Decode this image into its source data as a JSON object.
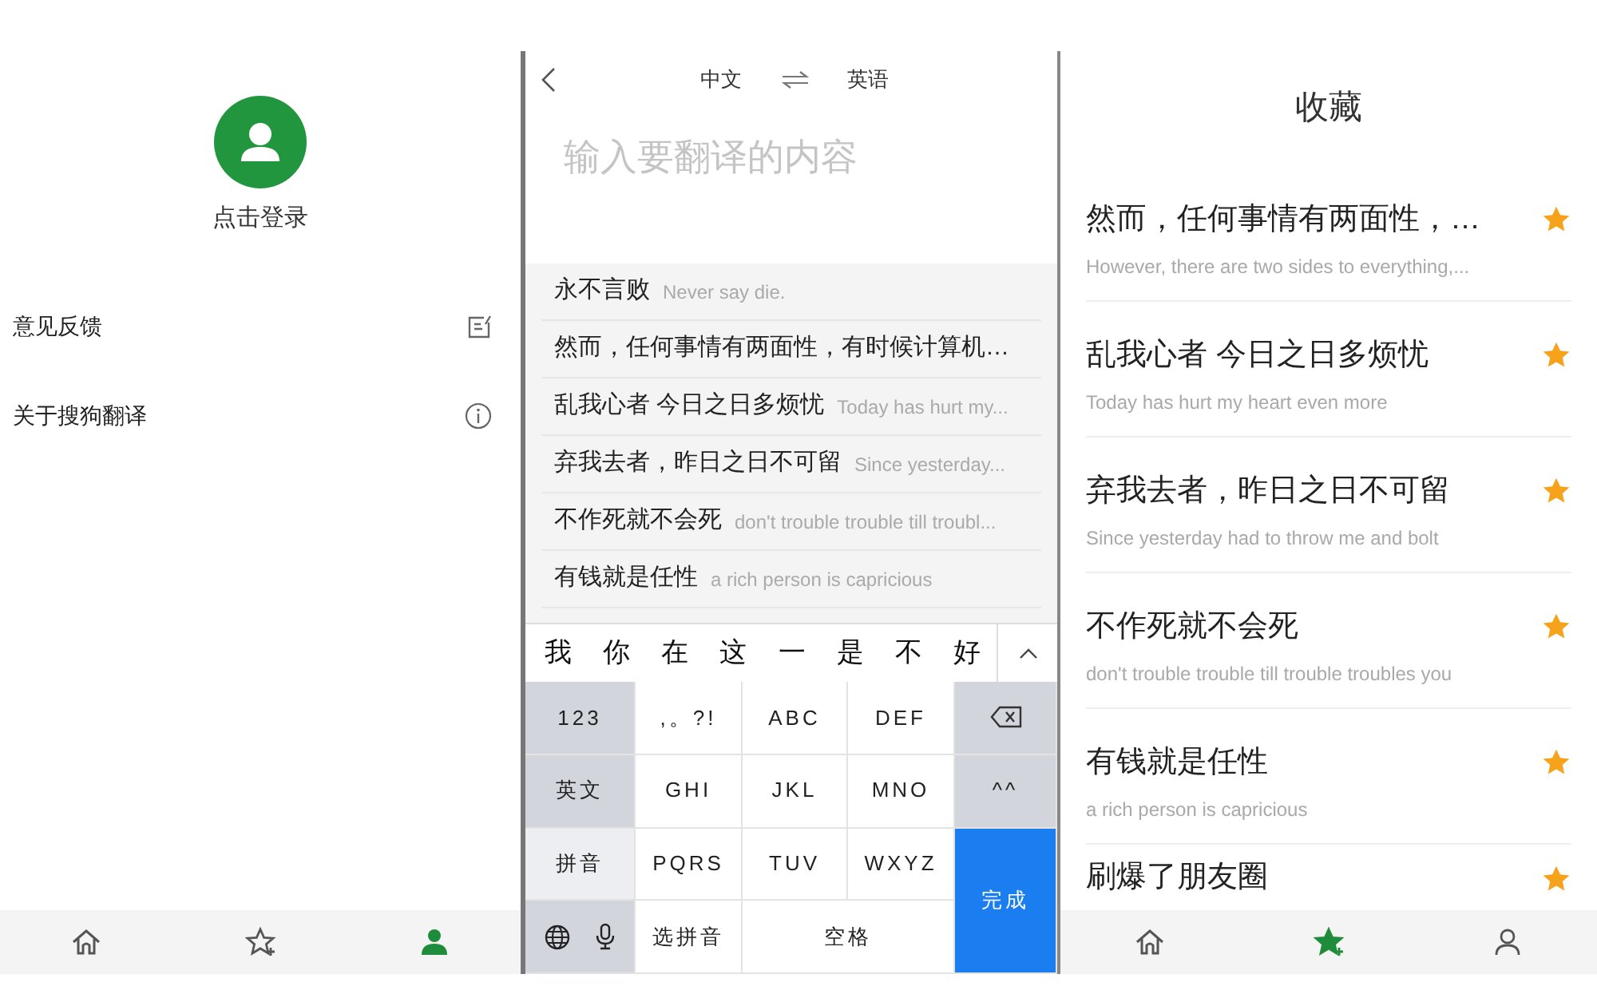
{
  "profile_screen": {
    "login_label": "点击登录",
    "menu": [
      {
        "label": "意见反馈",
        "kind": "feedback"
      },
      {
        "label": "关于搜狗翻译",
        "kind": "info"
      }
    ],
    "tabs": [
      {
        "kind": "home",
        "selected": false
      },
      {
        "kind": "favorites",
        "selected": false
      },
      {
        "kind": "profile",
        "selected": true
      }
    ]
  },
  "translate_screen": {
    "source_language": "中文",
    "target_language": "英语",
    "input": {
      "placeholder": "输入要翻译的内容"
    },
    "history": [
      {
        "source": "永不言败",
        "translation": "Never say die."
      },
      {
        "source": "然而，任何事情有两面性，有时候计算机…"
      },
      {
        "source": "乱我心者 今日之日多烦忧",
        "translation": "Today has hurt my..."
      },
      {
        "source": "弃我去者，昨日之日不可留",
        "translation": "Since yesterday..."
      },
      {
        "source": "不作死就不会死",
        "translation": "don't trouble trouble till troubl..."
      },
      {
        "source": "有钱就是任性",
        "translation": "a rich person is capricious"
      }
    ],
    "candidates": [
      "我",
      "你",
      "在",
      "这",
      "一",
      "是",
      "不",
      "好"
    ],
    "keyboard": [
      {
        "kind": "mode",
        "label": "123",
        "selected": false
      },
      {
        "kind": "letter",
        "label": ",。?!"
      },
      {
        "kind": "letter",
        "label": "ABC"
      },
      {
        "kind": "letter",
        "label": "DEF"
      },
      {
        "kind": "delete"
      },
      {
        "kind": "mode",
        "label": "英文",
        "selected": false
      },
      {
        "kind": "letter",
        "label": "GHI"
      },
      {
        "kind": "letter",
        "label": "JKL"
      },
      {
        "kind": "letter",
        "label": "MNO"
      },
      {
        "kind": "mode",
        "label": "^^",
        "selected": false
      },
      {
        "kind": "mode",
        "label": "拼音",
        "selected": true
      },
      {
        "kind": "letter",
        "label": "PQRS"
      },
      {
        "kind": "letter",
        "label": "TUV"
      },
      {
        "kind": "letter",
        "label": "WXYZ"
      },
      {
        "kind": "done",
        "label": "完成"
      },
      {
        "kind": "globe-mic"
      },
      {
        "kind": "letter",
        "label": "选拼音"
      },
      {
        "kind": "space",
        "label": "空格"
      }
    ]
  },
  "favorites_screen": {
    "title": "收藏",
    "items": [
      {
        "source": "然而，任何事情有两面性，…",
        "translation": "However, there are two sides to everything,..."
      },
      {
        "source": "乱我心者 今日之日多烦忧",
        "translation": "Today has hurt my heart even more"
      },
      {
        "source": "弃我去者，昨日之日不可留",
        "translation": "Since yesterday had to throw me and bolt"
      },
      {
        "source": "不作死就不会死",
        "translation": "don't trouble trouble till trouble troubles you"
      },
      {
        "source": "有钱就是任性",
        "translation": "a rich person is capricious"
      },
      {
        "source": "刷爆了朋友圈"
      }
    ],
    "tabs": [
      {
        "kind": "home",
        "selected": false
      },
      {
        "kind": "favorites",
        "selected": true
      },
      {
        "kind": "profile",
        "selected": false
      }
    ]
  }
}
